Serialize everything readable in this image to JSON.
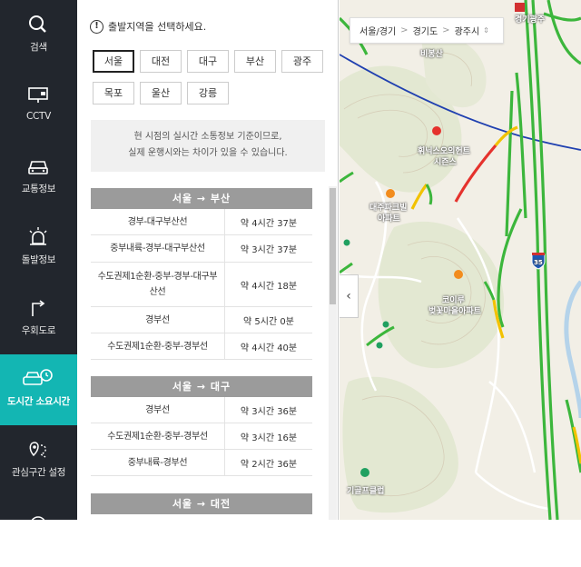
{
  "nav": {
    "items": [
      {
        "label": "검색",
        "icon": "search-icon"
      },
      {
        "label": "CCTV",
        "icon": "cctv-icon"
      },
      {
        "label": "교통정보",
        "icon": "car-icon"
      },
      {
        "label": "돌발정보",
        "icon": "siren-icon"
      },
      {
        "label": "우회도로",
        "icon": "detour-icon"
      },
      {
        "label": "도시간 소요시간",
        "icon": "car-clock-icon",
        "active": true
      },
      {
        "label": "관심구간 설정",
        "icon": "route-pin-icon"
      }
    ]
  },
  "panel": {
    "notice": "출발지역을 선택하세요.",
    "cities": [
      "서울",
      "대전",
      "대구",
      "부산",
      "광주",
      "목포",
      "울산",
      "강릉"
    ],
    "selected_city": "서울",
    "info_line1": "현 시점의 실시간 소통정보 기준이므로,",
    "info_line2": "실제 운행시와는 차이가 있을 수 있습니다.",
    "routes": [
      {
        "title": "서울 → 부산",
        "rows": [
          {
            "name": "경부-대구부산선",
            "time": "약 4시간 37분"
          },
          {
            "name": "중부내륙-경부-대구부산선",
            "time": "약 3시간 37분"
          },
          {
            "name": "수도권제1순환-중부-경부-대구부산선",
            "time": "약 4시간 18분"
          },
          {
            "name": "경부선",
            "time": "약 5시간 0분"
          },
          {
            "name": "수도권제1순환-중부-경부선",
            "time": "약 4시간 40분"
          }
        ]
      },
      {
        "title": "서울 → 대구",
        "rows": [
          {
            "name": "경부선",
            "time": "약 3시간 36분"
          },
          {
            "name": "수도권제1순환-중부-경부선",
            "time": "약 3시간 16분"
          },
          {
            "name": "중부내륙-경부선",
            "time": "약 2시간 36분"
          }
        ]
      },
      {
        "title": "서울 → 대전",
        "rows": []
      }
    ]
  },
  "map": {
    "breadcrumb": [
      "서울/경기",
      "경기도",
      "광주시"
    ],
    "labels": {
      "mountain": "비봉산",
      "apt1a": "휘닉스오의헌트",
      "apt1b": "시즌스",
      "apt2a": "대주파크빌",
      "apt2b": "아파트",
      "apt3a": "코이루",
      "apt3b": "벚꽃마을아파트",
      "place": "기골프클럽",
      "highway": "경기광주",
      "shield": "35"
    },
    "colors": {
      "road_green": "#3cb63c",
      "road_yellow": "#f2c200",
      "road_red": "#e5322d",
      "rail_blue": "#2040b0",
      "accent": "#13b6b3"
    }
  }
}
